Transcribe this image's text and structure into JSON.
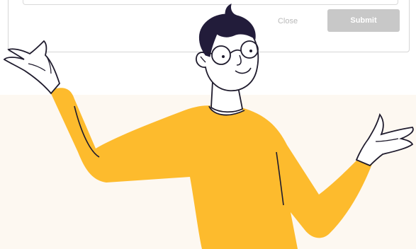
{
  "dialog": {
    "close_label": "Close",
    "submit_label": "Submit"
  },
  "illustration": {
    "subject": "shrugging-person-illustration"
  },
  "colors": {
    "shirt": "#fdbb2d",
    "hair": "#221c3a",
    "outline": "#1f1b2d",
    "background_light": "#fdf8f1",
    "submit_disabled": "#c8c8c8"
  }
}
